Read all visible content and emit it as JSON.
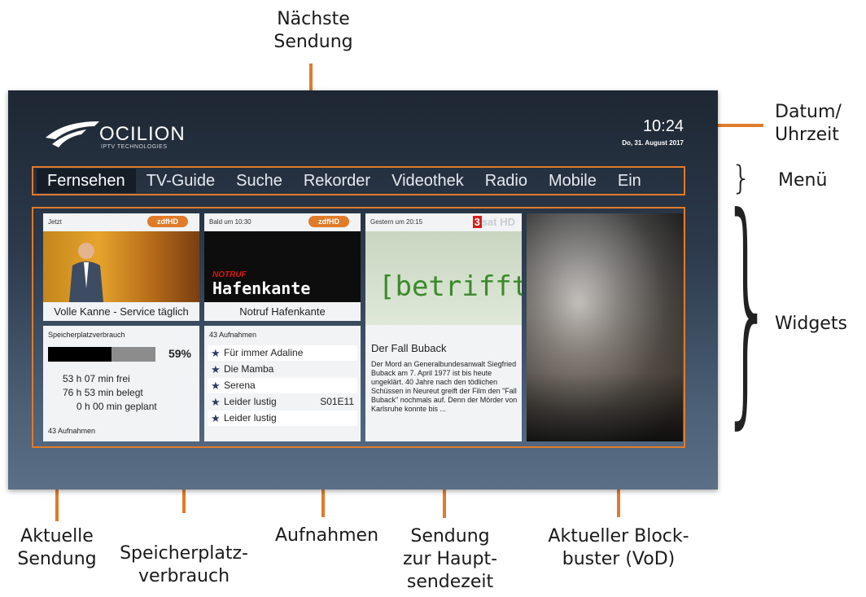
{
  "labels": {
    "naechste_sendung": "Nächste Sendung",
    "datum_uhrzeit": "Datum/ Uhrzeit",
    "menue": "Menü",
    "widgets": "Widgets",
    "aktuelle_sendung": "Aktuelle Sendung",
    "speicherplatz": "Speicherplatz- verbrauch",
    "aufnahmen": "Aufnahmen",
    "hauptsendezeit": "Sendung zur Haupt- sendezeit",
    "blockbuster": "Aktueller Block- buster (VoD)"
  },
  "header": {
    "logo_text": "OCILION",
    "logo_sub": "IPTV TECHNOLOGIES",
    "time": "10:24",
    "date": "Do, 31. August 2017"
  },
  "menu": {
    "items": [
      "Fernsehen",
      "TV-Guide",
      "Suche",
      "Rekorder",
      "Videothek",
      "Radio",
      "Mobile",
      "Ein"
    ]
  },
  "widgets": {
    "now": {
      "head": "Jetzt",
      "channel": "zdfHD",
      "caption": "Volle Kanne - Service täglich"
    },
    "next": {
      "head": "Bald um 10:30",
      "channel": "zdfHD",
      "caption": "Notruf Hafenkante",
      "image_small": "NOTRUF",
      "image_big": "Hafenkante"
    },
    "primetime": {
      "head": "Gestern um 20:15",
      "channel_prefix": "3",
      "channel_rest": "sat HD",
      "image_text": "[betrifft]",
      "title": "Der Fall Buback",
      "text": "Der Mord an Generalbundesanwalt Siegfried Buback am 7. April 1977 ist bis heute ungeklärt. 40 Jahre nach den tödlichen Schüssen in Neureut greift der Film den \"Fall Buback\" nochmals auf. Denn der Mörder von Karlsruhe konnte bis ..."
    },
    "storage": {
      "title": "Speicherplatzverbrauch",
      "percent": "59%",
      "fill": 0.59,
      "free": "53 h 07 min frei",
      "used": "76 h 53 min belegt",
      "planned": "0 h 00 min geplant",
      "footer": "43 Aufnahmen"
    },
    "recordings": {
      "title": "43 Aufnahmen",
      "items": [
        "Für immer Adaline",
        "Die Mamba",
        "Serena",
        "Leider lustig",
        "Leider lustig"
      ],
      "episode": "S01E11"
    }
  },
  "colors": {
    "accent": "#e07b2a",
    "screen_bg": "#2c3a4c"
  }
}
